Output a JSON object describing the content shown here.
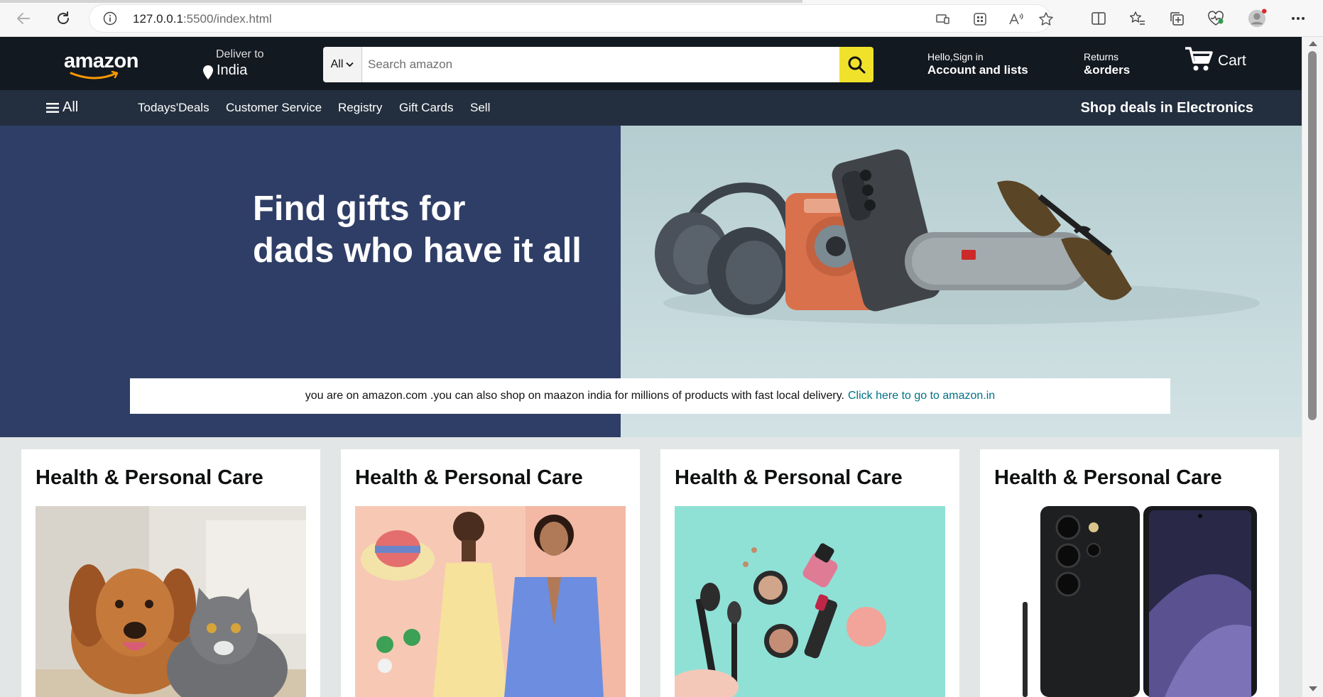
{
  "browser": {
    "url_host": "127.0.0.1",
    "url_rest": ":5500/index.html",
    "icons": [
      "back-icon",
      "reload-icon",
      "info-icon",
      "read-aloud-icon",
      "extensions-icon",
      "favorite-star-icon",
      "split-screen-icon",
      "favorites-icon",
      "collections-icon",
      "browser-essentials-icon",
      "profile-avatar-icon",
      "more-options-icon"
    ]
  },
  "header": {
    "logo_text": "amazon",
    "deliver_label": "Deliver to",
    "deliver_location": "India",
    "search": {
      "category": "All",
      "placeholder": "Search amazon"
    },
    "account": {
      "line1": "Hello,Sign in",
      "line2": "Account and lists"
    },
    "returns": {
      "line1": "Returns",
      "line2": "&orders"
    },
    "cart_label": "Cart"
  },
  "subnav": {
    "all_label": "All",
    "links": [
      "Todays'Deals",
      "Customer Service",
      "Registry",
      "Gift Cards",
      "Sell"
    ],
    "promo": "Shop deals in Electronics"
  },
  "hero": {
    "title_line1": "Find gifts for",
    "title_line2": "dads who have it all",
    "notice_text": "you are on amazon.com .you can also shop on maazon india for millions of products with fast local delivery.",
    "notice_link": "Click here to go to amazon.in"
  },
  "cards": [
    {
      "title": "Health & Personal Care"
    },
    {
      "title": "Health & Personal Care"
    },
    {
      "title": "Health & Personal Care"
    },
    {
      "title": "Health & Personal Care"
    }
  ],
  "colors": {
    "header_bg": "#131921",
    "subnav_bg": "#232f3e",
    "hero_left_bg": "#2f3e66",
    "search_button": "#f0e22b",
    "link": "#007185",
    "page_bg": "#e3e6e6"
  }
}
